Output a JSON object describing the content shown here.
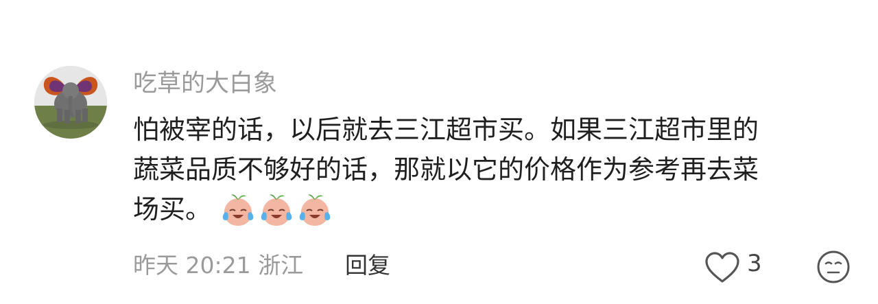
{
  "user": {
    "name": "吃草的大白象",
    "avatar_icon": "elephant-with-butterfly-ears-avatar"
  },
  "comment": {
    "lines": [
      "怕被宰的话，以后就去三江超市买。如果三江超市里的",
      "蔬菜品质不够好的话，那就以它的价格作为参考再去菜",
      "场买。"
    ],
    "emoji_icon": "crying-laughing-peach-emoji",
    "emoji_count": 3
  },
  "meta": {
    "time": "昨天 20:21",
    "location": "浙江",
    "reply_label": "回复"
  },
  "actions": {
    "like_icon": "heart-outline-icon",
    "like_count": "3",
    "expression_icon": "face-icon"
  },
  "colors": {
    "secondary_text": "#9a9a9a",
    "primary_text": "#1f1f1f"
  }
}
